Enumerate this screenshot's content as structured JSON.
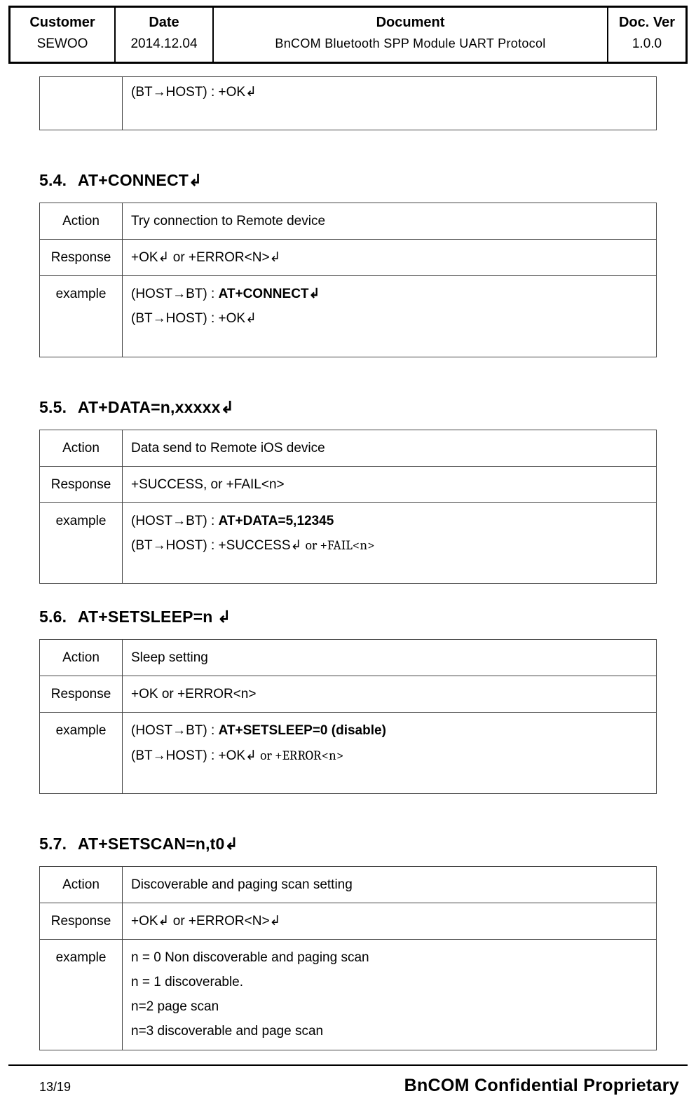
{
  "header": {
    "customer_label": "Customer",
    "customer_value": "SEWOO",
    "date_label": "Date",
    "date_value": "2014.12.04",
    "document_label": "Document",
    "document_value": "BnCOM Bluetooth SPP Module UART Protocol",
    "ver_label": "Doc. Ver",
    "ver_value": "1.0.0"
  },
  "orphan_row": {
    "value": "(BT→HOST) : +OK↲"
  },
  "sections": {
    "s54": {
      "num": "5.4.",
      "title": "AT+CONNECT↲",
      "rows": {
        "action_key": "Action",
        "action_val": "Try connection to Remote device",
        "response_key": "Response",
        "response_val": "+OK↲ or +ERROR<N>↲",
        "example_key": "example",
        "example_l1_pre": "(HOST→BT) : ",
        "example_l1_cmd": "AT+CONNECT↲",
        "example_l2": "(BT→HOST) : +OK↲"
      }
    },
    "s55": {
      "num": "5.5.",
      "title": "AT+DATA=n,xxxxx↲",
      "rows": {
        "action_key": "Action",
        "action_val": "Data send to Remote iOS device",
        "response_key": "Response",
        "response_val": "+SUCCESS, or +FAIL<n>",
        "example_key": "example",
        "example_l1_pre": "(HOST→BT) : ",
        "example_l1_cmd": "AT+DATA=5,12345",
        "example_l2_a": "(BT→HOST) : +SUCCESS↲ ",
        "example_l2_b": "or +FAIL<n>"
      }
    },
    "s56": {
      "num": "5.6.",
      "title": "AT+SETSLEEP=n ↲",
      "rows": {
        "action_key": "Action",
        "action_val": "Sleep setting",
        "response_key": "Response",
        "response_val": "+OK or +ERROR<n>",
        "example_key": "example",
        "example_l1_pre": "(HOST→BT) : ",
        "example_l1_cmd": "AT+SETSLEEP=0 (disable)",
        "example_l2_a": "(BT→HOST) : +OK↲ ",
        "example_l2_b": "or +ERROR<n>"
      }
    },
    "s57": {
      "num": "5.7.",
      "title": "AT+SETSCAN=n,t0↲",
      "rows": {
        "action_key": "Action",
        "action_val": "Discoverable and paging scan setting",
        "response_key": "Response",
        "response_val": "+OK↲ or +ERROR<N>↲",
        "example_key": "example",
        "example_l1": "n = 0   Non discoverable and paging scan",
        "example_l2": "n = 1   discoverable.",
        "example_l3": "n=2   page scan",
        "example_l4": "n=3   discoverable and page scan"
      }
    }
  },
  "footer": {
    "page": "13/19",
    "confidential": "BnCOM Confidential Proprietary"
  }
}
